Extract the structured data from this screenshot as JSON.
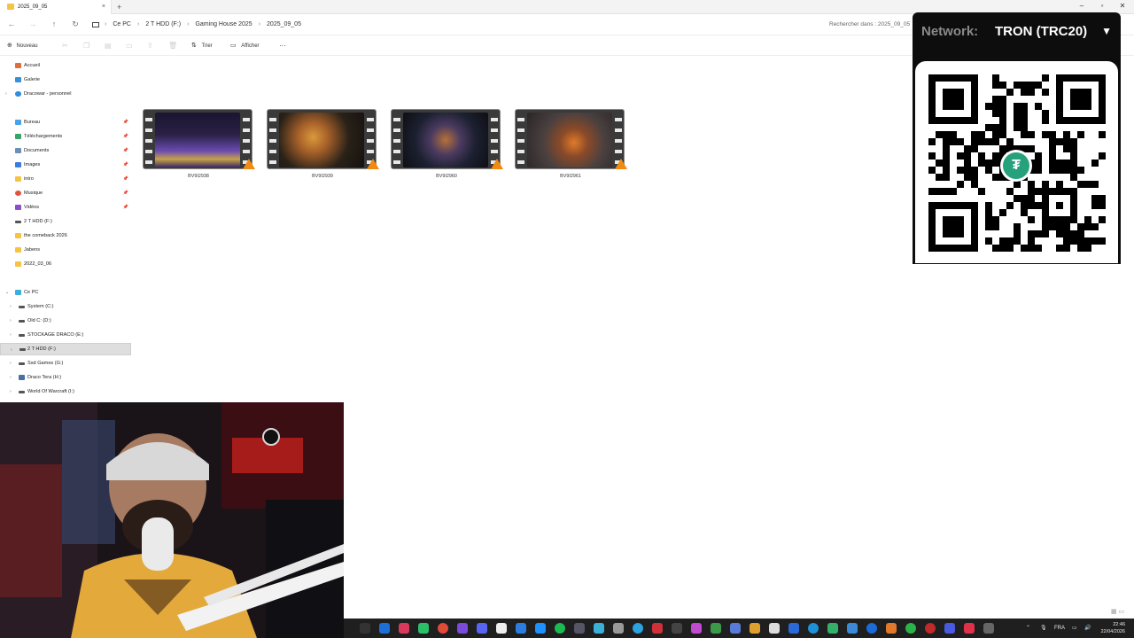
{
  "window": {
    "tab_title": "2025_09_05",
    "tab_close": "×",
    "new_tab": "+",
    "minimize": "–",
    "maximize": "▫",
    "close": "✕"
  },
  "addressbar": {
    "breadcrumbs": [
      "Ce PC",
      "2 T HDD (F:)",
      "Gaming House 2025",
      "2025_09_05"
    ],
    "separator": "›",
    "search_placeholder": "Rechercher dans : 2025_09_05"
  },
  "toolbar": {
    "new_label": "Nouveau",
    "sort_label": "Trier",
    "view_label": "Afficher",
    "more_label": "···"
  },
  "sidebar": {
    "top": [
      {
        "label": "Accueil",
        "icon": "home-icon"
      },
      {
        "label": "Galerie",
        "icon": "gallery-icon"
      },
      {
        "label": "Dracowar - personnel",
        "icon": "onedrive-icon"
      }
    ],
    "pinned": [
      {
        "label": "Bureau",
        "icon": "desktop-icon"
      },
      {
        "label": "Téléchargements",
        "icon": "download-icon"
      },
      {
        "label": "Documents",
        "icon": "documents-icon"
      },
      {
        "label": "Images",
        "icon": "images-icon"
      },
      {
        "label": "intro",
        "icon": "folder-icon"
      },
      {
        "label": "Musique",
        "icon": "music-icon"
      },
      {
        "label": "Vidéos",
        "icon": "videos-icon"
      },
      {
        "label": "2 T HDD (F:)",
        "icon": "drive-icon"
      },
      {
        "label": "the comeback 2026",
        "icon": "folder-icon"
      },
      {
        "label": "Jabens",
        "icon": "folder-icon"
      },
      {
        "label": "2022_03_06",
        "icon": "folder-icon"
      }
    ],
    "this_pc": {
      "label": "Ce PC",
      "icon": "pc-icon"
    },
    "drives": [
      {
        "label": "System (C:)"
      },
      {
        "label": "Old C: (D:)"
      },
      {
        "label": "STOCKAGE DRACO (E:)"
      },
      {
        "label": "2 T HDD (F:)"
      },
      {
        "label": "Ssd Games (G:)"
      },
      {
        "label": "Draco Tera (H:)"
      },
      {
        "label": "World Of Warcraft (I:)"
      }
    ]
  },
  "files": [
    {
      "name": "BV9I2938"
    },
    {
      "name": "BV9I2939"
    },
    {
      "name": "BV9I2960"
    },
    {
      "name": "BV9I2961"
    }
  ],
  "qr_overlay": {
    "network_label": "Network:",
    "network_value": "TRON (TRC20)",
    "caret": "▼",
    "logo_glyph": "₮"
  },
  "taskbar": {
    "language": "FRA",
    "time": "22:46",
    "date": "22/04/2026"
  },
  "colors": {
    "accent_folder": "#f6c343",
    "vlc_cone": "#f08a12",
    "tether_green": "#26a17b"
  }
}
